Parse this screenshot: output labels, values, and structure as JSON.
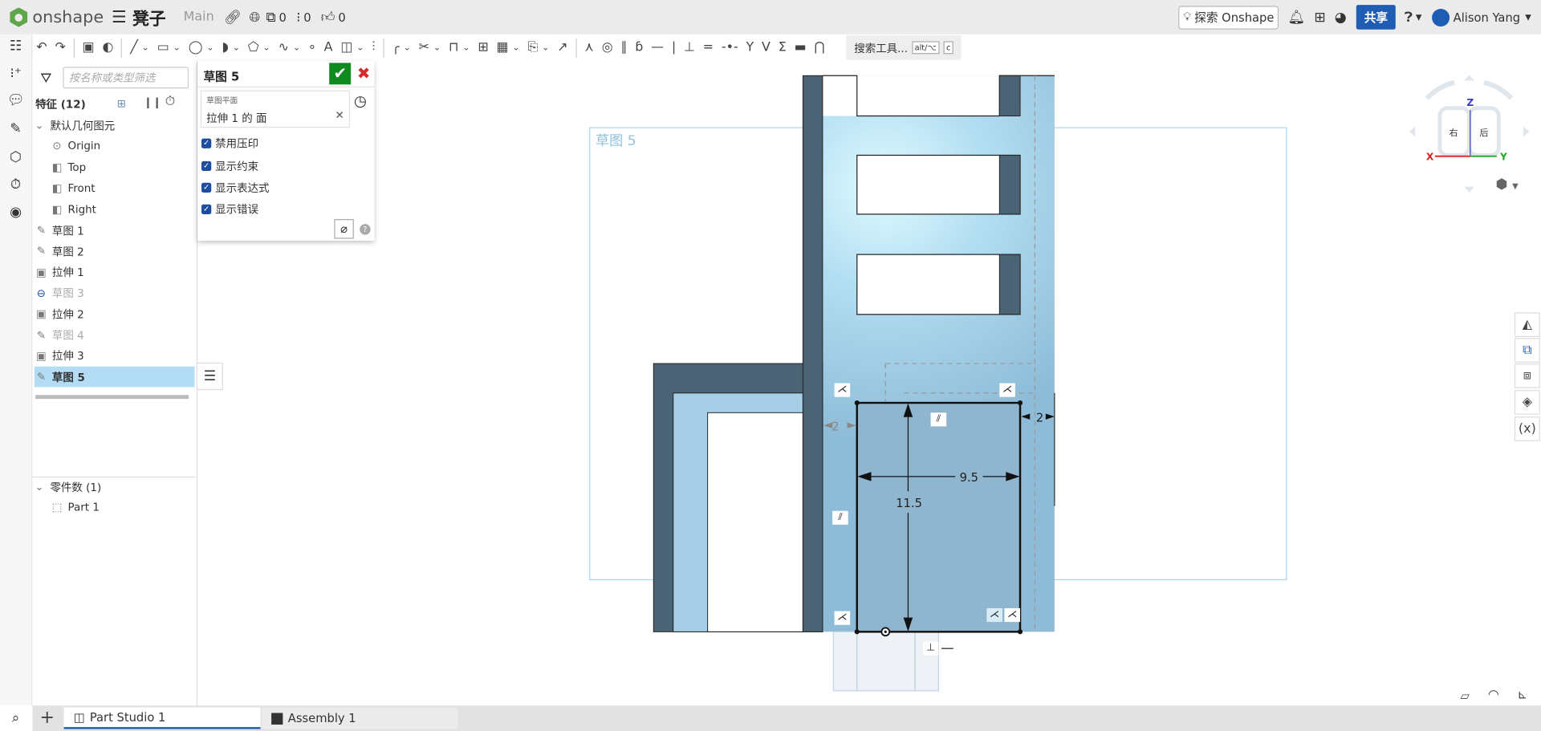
{
  "topbar": {
    "brand": "onshape",
    "menu_icon": "hamburger-icon",
    "document_title": "凳子",
    "branch": "Main",
    "copies_count": "0",
    "versions_count": "0",
    "likes_count": "0",
    "explore_label": "探索 Onshape",
    "share_label": "共享",
    "user_name": "Alison Yang",
    "share_color": "#1f5cb4"
  },
  "toolbar": {
    "tools": [
      {
        "name": "undo",
        "glyph": "↶",
        "dropdown": false
      },
      {
        "name": "redo",
        "glyph": "↷",
        "dropdown": false
      },
      {
        "name": "sep"
      },
      {
        "name": "feature-list-sketch",
        "glyph": "▣",
        "dropdown": false
      },
      {
        "name": "sketch-color",
        "glyph": "◐",
        "dropdown": false
      },
      {
        "name": "sep"
      },
      {
        "name": "line",
        "glyph": "╱",
        "dropdown": true
      },
      {
        "name": "rectangle",
        "glyph": "▭",
        "dropdown": true
      },
      {
        "name": "circle",
        "glyph": "◯",
        "dropdown": true
      },
      {
        "name": "arc",
        "glyph": "◗",
        "dropdown": true
      },
      {
        "name": "polygon",
        "glyph": "⬠",
        "dropdown": true
      },
      {
        "name": "spline",
        "glyph": "∿",
        "dropdown": true
      },
      {
        "name": "point",
        "glyph": "∘",
        "dropdown": false
      },
      {
        "name": "text",
        "glyph": "A",
        "dropdown": false
      },
      {
        "name": "use-project",
        "glyph": "◫",
        "dropdown": true
      },
      {
        "name": "mirror",
        "glyph": "⫶",
        "dropdown": false
      },
      {
        "name": "sep"
      },
      {
        "name": "fillet",
        "glyph": "╭",
        "dropdown": true
      },
      {
        "name": "trim",
        "glyph": "✂",
        "dropdown": true
      },
      {
        "name": "offset",
        "glyph": "⊓",
        "dropdown": true
      },
      {
        "name": "transform",
        "glyph": "⊞",
        "dropdown": false
      },
      {
        "name": "pattern",
        "glyph": "▦",
        "dropdown": true
      },
      {
        "name": "dxf-import",
        "glyph": "⎘",
        "dropdown": true
      },
      {
        "name": "dimension",
        "glyph": "↗",
        "dropdown": false
      },
      {
        "name": "sep"
      },
      {
        "name": "coincident",
        "glyph": "⋏",
        "dropdown": false
      },
      {
        "name": "concentric",
        "glyph": "◎",
        "dropdown": false
      },
      {
        "name": "parallel",
        "glyph": "∥",
        "dropdown": false
      },
      {
        "name": "tangent",
        "glyph": "ɓ",
        "dropdown": false
      },
      {
        "name": "horizontal",
        "glyph": "—",
        "dropdown": false
      },
      {
        "name": "vertical",
        "glyph": "|",
        "dropdown": false
      },
      {
        "name": "perpendicular",
        "glyph": "⊥",
        "dropdown": false
      },
      {
        "name": "equal",
        "glyph": "=",
        "dropdown": false
      },
      {
        "name": "midpoint",
        "glyph": "-•-",
        "dropdown": false
      },
      {
        "name": "normal",
        "glyph": "Y",
        "dropdown": false
      },
      {
        "name": "pierce",
        "glyph": "V",
        "dropdown": false
      },
      {
        "name": "symmetric",
        "glyph": "Σ",
        "dropdown": false
      },
      {
        "name": "fix",
        "glyph": "▬",
        "dropdown": false
      },
      {
        "name": "curvature",
        "glyph": "⋂",
        "dropdown": false
      }
    ],
    "search_label": "搜索工具...",
    "shortcut_1": "alt/⌥",
    "shortcut_2": "c"
  },
  "feature_panel": {
    "filter_placeholder": "按名称或类型筛选",
    "features_header": "特征 (12)",
    "default_geometry": "默认几何图元",
    "default_items": [
      "Origin",
      "Top",
      "Front",
      "Right"
    ],
    "features": [
      {
        "label": "草图 1",
        "type": "sketch",
        "state": "normal"
      },
      {
        "label": "草图 2",
        "type": "sketch",
        "state": "normal"
      },
      {
        "label": "拉伸 1",
        "type": "extrude",
        "state": "normal"
      },
      {
        "label": "草图 3",
        "type": "sketch",
        "state": "disabled"
      },
      {
        "label": "拉伸 2",
        "type": "extrude",
        "state": "normal"
      },
      {
        "label": "草图 4",
        "type": "sketch",
        "state": "dim"
      },
      {
        "label": "拉伸 3",
        "type": "extrude",
        "state": "normal"
      },
      {
        "label": "草图 5",
        "type": "sketch",
        "state": "selected"
      }
    ],
    "parts_header": "零件数 (1)",
    "parts": [
      "Part 1"
    ]
  },
  "sketch_dialog": {
    "title": "草图 5",
    "plane_label": "草图平面",
    "plane_value": "拉伸 1 的 面",
    "options": [
      {
        "label": "禁用压印",
        "checked": true
      },
      {
        "label": "显示约束",
        "checked": true
      },
      {
        "label": "显示表达式",
        "checked": true
      },
      {
        "label": "显示错误",
        "checked": true
      }
    ],
    "confirm_color": "#0f8a1e",
    "cancel_color": "#d42a2a"
  },
  "viewport": {
    "sketch_plane_label": "草图 5",
    "dimensions": {
      "width": "9.5",
      "height": "11.5",
      "left_offset": "2",
      "right_offset": "2"
    },
    "view_cube": {
      "left_face": "右",
      "front_face": "后",
      "axis_x": "X",
      "axis_y": "Y",
      "axis_z": "Z"
    }
  },
  "tabs": [
    {
      "label": "Part Studio 1",
      "active": true
    },
    {
      "label": "Assembly 1",
      "active": false
    }
  ]
}
